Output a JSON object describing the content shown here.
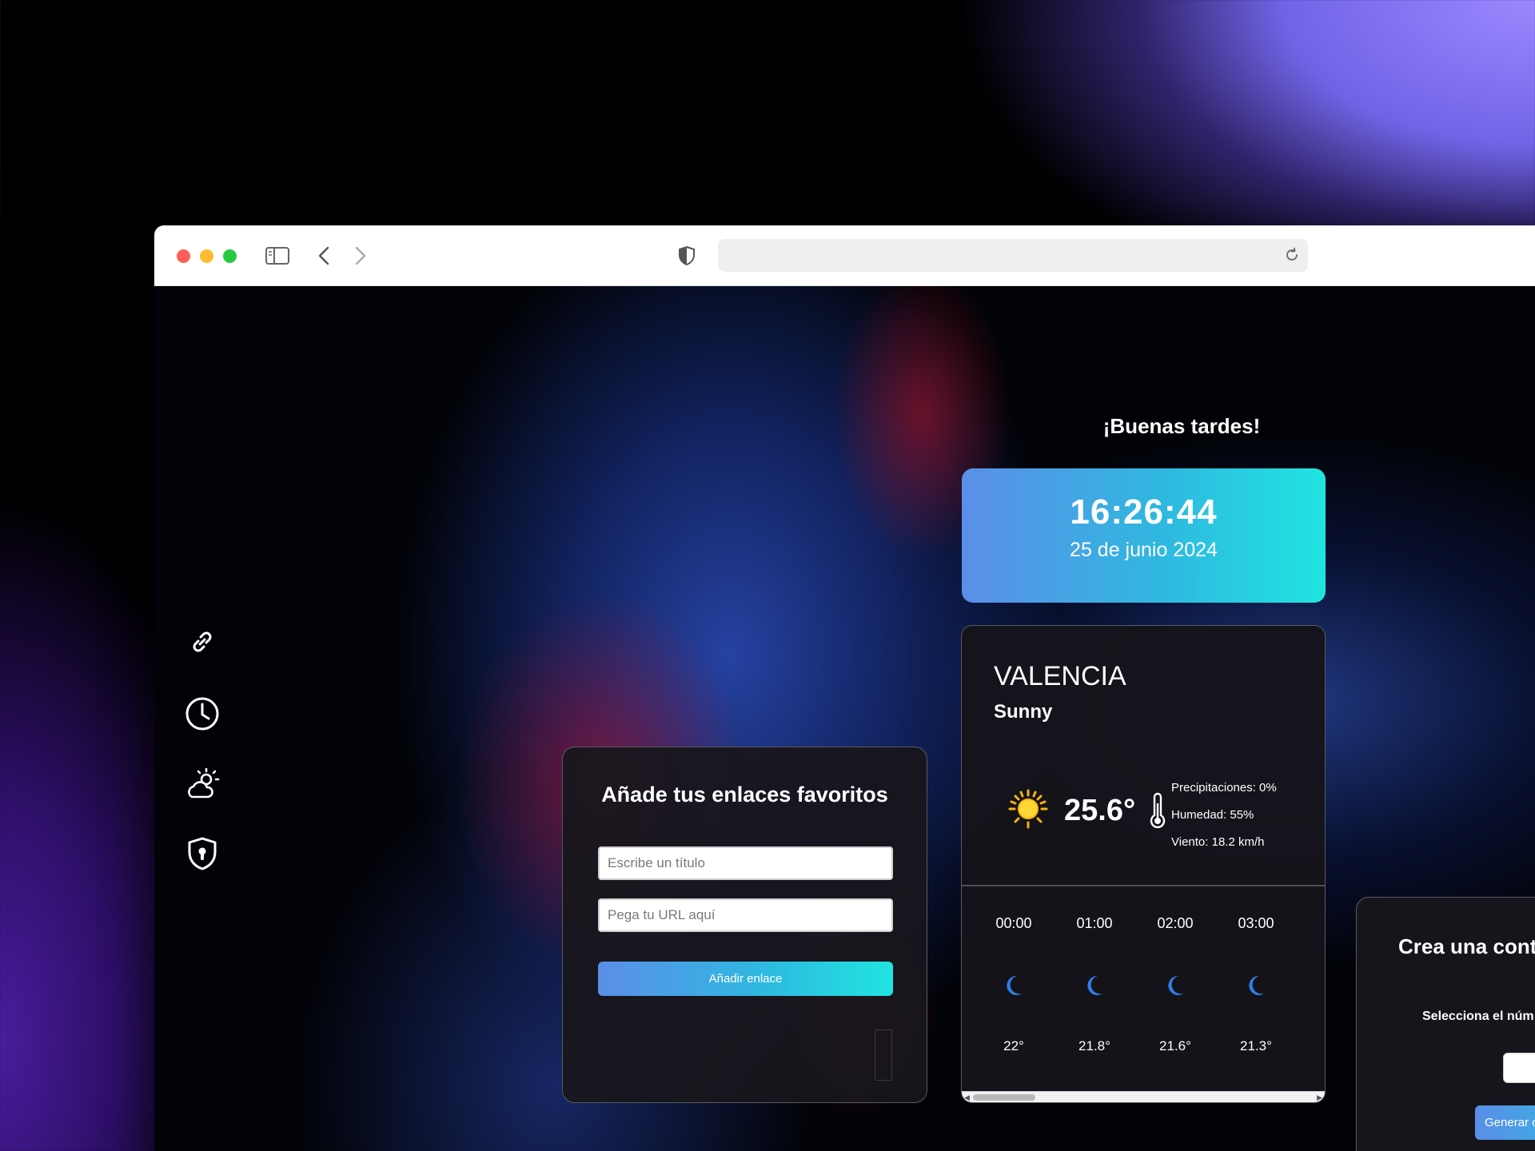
{
  "greeting": "¡Buenas tardes!",
  "clock": {
    "time": "16:26:44",
    "date": "25 de junio 2024"
  },
  "weather": {
    "city": "VALENCIA",
    "condition": "Sunny",
    "icon": "sun-icon",
    "temperature": "25.6°",
    "details": {
      "precipitation": "Precipitaciones: 0%",
      "humidity": "Humedad: 55%",
      "wind": "Viento: 18.2 km/h"
    },
    "hourly": [
      {
        "time": "00:00",
        "icon": "moon-icon",
        "temp": "22°"
      },
      {
        "time": "01:00",
        "icon": "moon-icon",
        "temp": "21.8°"
      },
      {
        "time": "02:00",
        "icon": "moon-icon",
        "temp": "21.6°"
      },
      {
        "time": "03:00",
        "icon": "moon-icon",
        "temp": "21.3°"
      }
    ]
  },
  "links": {
    "title": "Añade tus enlaces favoritos",
    "title_placeholder": "Escribe un título",
    "url_placeholder": "Pega tu URL aquí",
    "button": "Añadir enlace"
  },
  "password": {
    "title": "Crea una cont",
    "label": "Selecciona el núm",
    "button": "Generar c"
  },
  "sidebar": {
    "items": [
      {
        "icon": "link-icon"
      },
      {
        "icon": "clock-icon"
      },
      {
        "icon": "partly-cloudy-icon"
      },
      {
        "icon": "shield-keyhole-icon"
      }
    ]
  },
  "colors": {
    "accent_start": "#5b8ee8",
    "accent_end": "#20e4e0",
    "card_bg": "#16141a"
  }
}
